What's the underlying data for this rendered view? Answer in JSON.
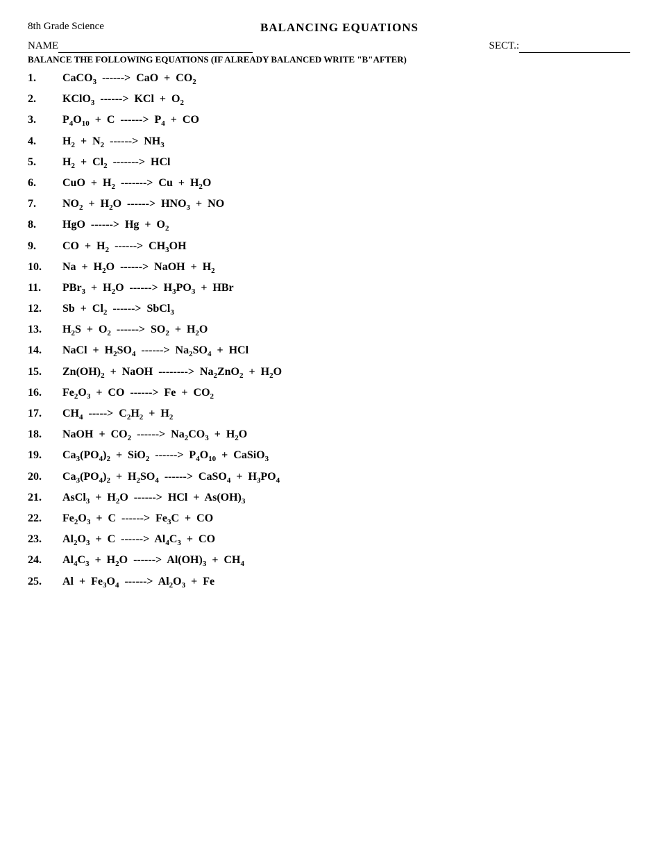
{
  "header": {
    "subject": "8th Grade Science",
    "title": "BALANCING EQUATIONS",
    "name_label": "NAME",
    "name_underline": "",
    "sect_label": "SECT.:",
    "sect_underline": "",
    "instruction": "BALANCE THE FOLLOWING EQUATIONS (IF ALREADY BALANCED WRITE \"B\"AFTER)"
  },
  "equations": [
    {
      "num": "1.",
      "html": "CaCO<sub>3</sub> &nbsp;------&gt;&nbsp; CaO &nbsp;+&nbsp; CO<sub>2</sub>"
    },
    {
      "num": "2.",
      "html": "KClO<sub>3</sub> &nbsp;------&gt;&nbsp; KCl &nbsp;+&nbsp; O<sub>2</sub>"
    },
    {
      "num": "3.",
      "html": "P<sub>4</sub>O<sub>10</sub> &nbsp;+&nbsp; C &nbsp;------&gt;&nbsp; P<sub>4</sub> &nbsp;+&nbsp; CO"
    },
    {
      "num": "4.",
      "html": "H<sub>2</sub> &nbsp;+&nbsp; N<sub>2</sub> &nbsp;------&gt;&nbsp; NH<sub>3</sub>"
    },
    {
      "num": "5.",
      "html": "H<sub>2</sub> &nbsp;+&nbsp; Cl<sub>2</sub> &nbsp;-------&gt;&nbsp; HCl"
    },
    {
      "num": "6.",
      "html": "CuO &nbsp;+&nbsp; H<sub>2</sub> &nbsp;-------&gt;&nbsp; Cu &nbsp;+&nbsp; H<sub>2</sub>O"
    },
    {
      "num": "7.",
      "html": "NO<sub>2</sub> &nbsp;+&nbsp; H<sub>2</sub>O &nbsp;------&gt;&nbsp; HNO<sub>3</sub> &nbsp;+&nbsp; NO"
    },
    {
      "num": "8.",
      "html": "HgO &nbsp;------&gt;&nbsp; Hg &nbsp;+&nbsp; O<sub>2</sub>"
    },
    {
      "num": "9.",
      "html": "CO &nbsp;+&nbsp; H<sub>2</sub> &nbsp;------&gt;&nbsp; CH<sub>3</sub>OH"
    },
    {
      "num": "10.",
      "html": "Na &nbsp;+&nbsp; H<sub>2</sub>O &nbsp;------&gt;&nbsp; NaOH &nbsp;+&nbsp; H<sub>2</sub>"
    },
    {
      "num": "11.",
      "html": "PBr<sub>3</sub> &nbsp;+&nbsp; H<sub>2</sub>O &nbsp;------&gt;&nbsp; H<sub>3</sub>PO<sub>3</sub> &nbsp;+&nbsp; HBr"
    },
    {
      "num": "12.",
      "html": "Sb &nbsp;+&nbsp; Cl<sub>2</sub> &nbsp;------&gt;&nbsp; SbCl<sub>3</sub>"
    },
    {
      "num": "13.",
      "html": "H<sub>2</sub>S &nbsp;+&nbsp; O<sub>2</sub> &nbsp;------&gt;&nbsp; SO<sub>2</sub> &nbsp;+&nbsp; H<sub>2</sub>O"
    },
    {
      "num": "14.",
      "html": "NaCl &nbsp;+&nbsp; H<sub>2</sub>SO<sub>4</sub> &nbsp;------&gt;&nbsp; Na<sub>2</sub>SO<sub>4</sub> &nbsp;+&nbsp; HCl"
    },
    {
      "num": "15.",
      "html": "Zn(OH)<sub>2</sub> &nbsp;+&nbsp; NaOH &nbsp;--------&gt;&nbsp; Na<sub>2</sub>ZnO<sub>2</sub> &nbsp;+&nbsp; H<sub>2</sub>O"
    },
    {
      "num": "16.",
      "html": "Fe<sub>2</sub>O<sub>3</sub> &nbsp;+&nbsp; CO &nbsp;------&gt;&nbsp; Fe &nbsp;+&nbsp; CO<sub>2</sub>"
    },
    {
      "num": "17.",
      "html": "CH<sub>4</sub> &nbsp;-----&gt;&nbsp; C<sub>2</sub>H<sub>2</sub> &nbsp;+&nbsp; H<sub>2</sub>"
    },
    {
      "num": "18.",
      "html": "NaOH &nbsp;+&nbsp; CO<sub>2</sub> &nbsp;------&gt;&nbsp; Na<sub>2</sub>CO<sub>3</sub> &nbsp;+&nbsp; H<sub>2</sub>O"
    },
    {
      "num": "19.",
      "html": "Ca<sub>3</sub>(PO<sub>4</sub>)<sub>2</sub> &nbsp;+&nbsp; SiO<sub>2</sub> &nbsp;------&gt;&nbsp; P<sub>4</sub>O<sub>10</sub> &nbsp;+&nbsp; CaSiO<sub>3</sub>"
    },
    {
      "num": "20.",
      "html": "Ca<sub>3</sub>(PO<sub>4</sub>)<sub>2</sub> &nbsp;+&nbsp; H<sub>2</sub>SO<sub>4</sub> &nbsp;------&gt;&nbsp; CaSO<sub>4</sub> &nbsp;+&nbsp; H<sub>3</sub>PO<sub>4</sub>"
    },
    {
      "num": "21.",
      "html": "AsCl<sub>3</sub> &nbsp;+&nbsp; H<sub>2</sub>O &nbsp;------&gt;&nbsp; HCl &nbsp;+&nbsp; As(OH)<sub>3</sub>"
    },
    {
      "num": "22.",
      "html": "Fe<sub>2</sub>O<sub>3</sub> &nbsp;+&nbsp; C &nbsp;------&gt;&nbsp; Fe<sub>3</sub>C &nbsp;+&nbsp; CO"
    },
    {
      "num": "23.",
      "html": "Al<sub>2</sub>O<sub>3</sub> &nbsp;+&nbsp; C &nbsp;------&gt;&nbsp; Al<sub>4</sub>C<sub>3</sub> &nbsp;+&nbsp; CO"
    },
    {
      "num": "24.",
      "html": "Al<sub>4</sub>C<sub>3</sub> &nbsp;+&nbsp; H<sub>2</sub>O &nbsp;------&gt;&nbsp; Al(OH)<sub>3</sub> &nbsp;+&nbsp; CH<sub>4</sub>"
    },
    {
      "num": "25.",
      "html": "Al &nbsp;+&nbsp; Fe<sub>3</sub>O<sub>4</sub> &nbsp;------&gt;&nbsp; Al<sub>2</sub>O<sub>3</sub> &nbsp;+&nbsp; Fe"
    }
  ]
}
